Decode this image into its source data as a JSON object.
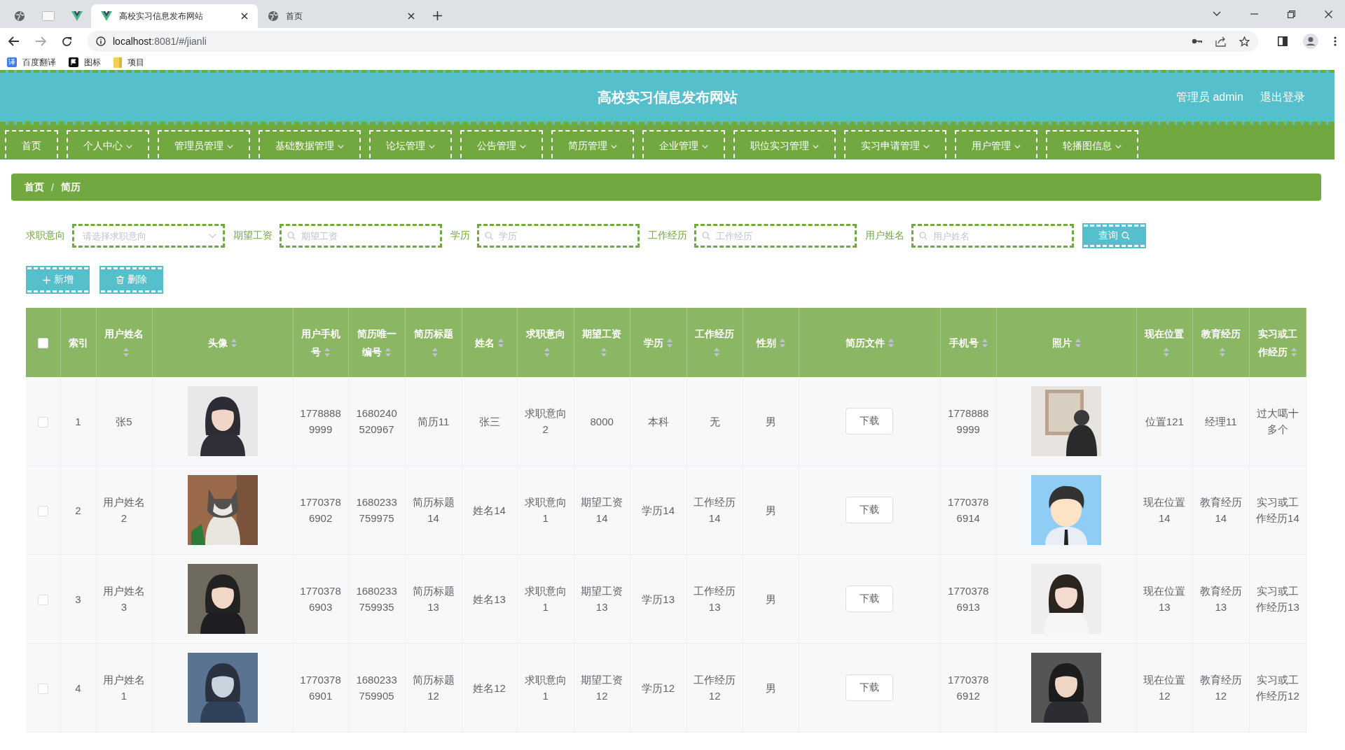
{
  "browser": {
    "tabs": [
      {
        "selected": false
      },
      {
        "selected": false
      },
      {
        "selected": false
      },
      {
        "title": "高校实习信息发布网站",
        "selected": true
      },
      {
        "title": "首页",
        "selected": false
      }
    ],
    "address": {
      "host": "localhost",
      "rest": ":8081/#/jianli"
    },
    "bookmarks": [
      {
        "icon_text": "译",
        "label": "百度翻译"
      },
      {
        "label": "图标"
      },
      {
        "label": "项目"
      }
    ]
  },
  "header": {
    "title": "高校实习信息发布网站",
    "user": "管理员 admin",
    "logout": "退出登录"
  },
  "nav": [
    {
      "label": "首页",
      "dropdown": false
    },
    {
      "label": "个人中心",
      "dropdown": true
    },
    {
      "label": "管理员管理",
      "dropdown": true
    },
    {
      "label": "基础数据管理",
      "dropdown": true
    },
    {
      "label": "论坛管理",
      "dropdown": true
    },
    {
      "label": "公告管理",
      "dropdown": true
    },
    {
      "label": "简历管理",
      "dropdown": true
    },
    {
      "label": "企业管理",
      "dropdown": true
    },
    {
      "label": "职位实习管理",
      "dropdown": true
    },
    {
      "label": "实习申请管理",
      "dropdown": true
    },
    {
      "label": "用户管理",
      "dropdown": true
    },
    {
      "label": "轮播图信息",
      "dropdown": true
    }
  ],
  "breadcrumb": {
    "items": [
      "首页",
      "简历"
    ],
    "separator": "/"
  },
  "filters": [
    {
      "kind": "select",
      "label": "求职意向",
      "placeholder": "请选择求职意向"
    },
    {
      "kind": "input",
      "label": "期望工资",
      "placeholder": "期望工资"
    },
    {
      "kind": "input",
      "label": "学历",
      "placeholder": "学历"
    },
    {
      "kind": "input",
      "label": "工作经历",
      "placeholder": "工作经历"
    },
    {
      "kind": "input",
      "label": "用户姓名",
      "placeholder": "用户姓名"
    }
  ],
  "search_button": "查询",
  "actions": [
    {
      "kind": "add",
      "label": "新增"
    },
    {
      "kind": "delete",
      "label": "删除"
    }
  ],
  "table": {
    "select_all": {
      "checked": false
    },
    "columns": [
      {
        "label": "索引",
        "sortable": false
      },
      {
        "label": "用户姓名",
        "sortable": true
      },
      {
        "label": "头像",
        "sortable": true,
        "kind": "picture"
      },
      {
        "label": "用户手机号",
        "sortable": true
      },
      {
        "label": "简历唯一编号",
        "sortable": true
      },
      {
        "label": "简历标题",
        "sortable": true
      },
      {
        "label": "姓名",
        "sortable": true
      },
      {
        "label": "求职意向",
        "sortable": true
      },
      {
        "label": "期望工资",
        "sortable": true
      },
      {
        "label": "学历",
        "sortable": true
      },
      {
        "label": "工作经历",
        "sortable": true
      },
      {
        "label": "性别",
        "sortable": true
      },
      {
        "label": "简历文件",
        "sortable": true,
        "kind": "button"
      },
      {
        "label": "手机号",
        "sortable": true
      },
      {
        "label": "照片",
        "sortable": true,
        "kind": "picture"
      },
      {
        "label": "现在位置",
        "sortable": true
      },
      {
        "label": "教育经历",
        "sortable": true
      },
      {
        "label": "实习或工作经历",
        "sortable": true
      }
    ],
    "rows": [
      {
        "checked": false,
        "cells": [
          "1",
          "张5",
          {
            "kind": "picture"
          },
          "17788889999",
          "1680240520967",
          "简历11",
          "张三",
          "求职意向2",
          "8000",
          "本科",
          "无",
          "男",
          "下载",
          "17788889999",
          {
            "kind": "picture"
          },
          "位置121",
          "经理11",
          "过大噶十多个"
        ]
      },
      {
        "checked": false,
        "cells": [
          "2",
          "用户姓名2",
          {
            "kind": "picture"
          },
          "17703786902",
          "1680233759975",
          "简历标题14",
          "姓名14",
          "求职意向1",
          "期望工资14",
          "学历14",
          "工作经历14",
          "男",
          "下载",
          "17703786914",
          {
            "kind": "picture"
          },
          "现在位置14",
          "教育经历14",
          "实习或工作经历14"
        ]
      },
      {
        "checked": false,
        "cells": [
          "3",
          "用户姓名3",
          {
            "kind": "picture"
          },
          "17703786903",
          "1680233759935",
          "简历标题13",
          "姓名13",
          "求职意向1",
          "期望工资13",
          "学历13",
          "工作经历13",
          "男",
          "下载",
          "17703786913",
          {
            "kind": "picture"
          },
          "现在位置13",
          "教育经历13",
          "实习或工作经历13"
        ]
      },
      {
        "checked": false,
        "cells": [
          "4",
          "用户姓名1",
          {
            "kind": "picture"
          },
          "17703786901",
          "1680233759905",
          "简历标题12",
          "姓名12",
          "求职意向1",
          "期望工资12",
          "学历12",
          "工作经历12",
          "男",
          "下载",
          "17703786912",
          {
            "kind": "picture"
          },
          "现在位置12",
          "教育经历12",
          "实习或工作经历12"
        ]
      }
    ]
  }
}
